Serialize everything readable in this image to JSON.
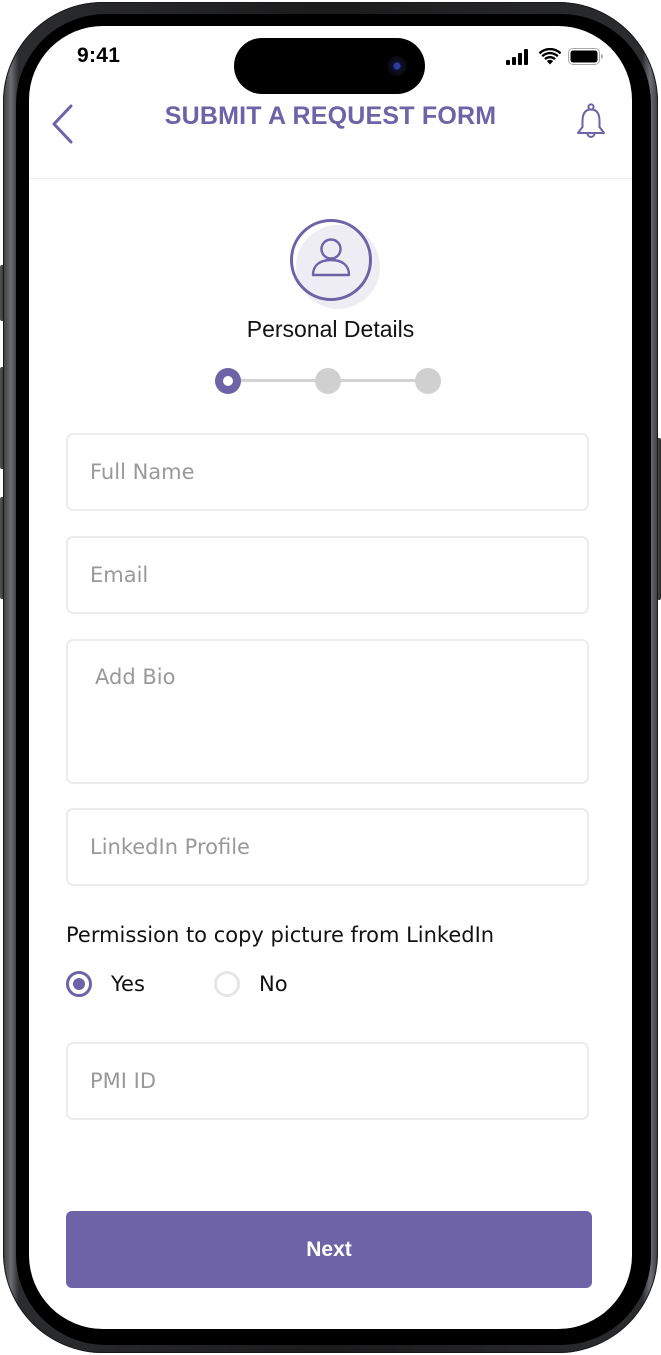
{
  "status_bar": {
    "time": "9:41",
    "icons": [
      "cellular-signal-icon",
      "wifi-icon",
      "battery-icon"
    ]
  },
  "header": {
    "title": "SUBMIT A REQUEST FORM",
    "back_icon": "chevron-left-icon",
    "notification_icon": "bell-icon"
  },
  "step": {
    "icon": "user-icon",
    "title": "Personal Details",
    "total_steps": 3,
    "current_step": 1
  },
  "form": {
    "full_name": {
      "value": "",
      "placeholder": "Full Name"
    },
    "email": {
      "value": "",
      "placeholder": "Email"
    },
    "bio": {
      "value": "",
      "placeholder": "Add Bio"
    },
    "linkedin": {
      "value": "",
      "placeholder": "LinkedIn Profile"
    },
    "permission": {
      "label": "Permission to copy picture from LinkedIn",
      "options": [
        {
          "label": "Yes",
          "selected": true
        },
        {
          "label": "No",
          "selected": false
        }
      ]
    },
    "pmi_id": {
      "value": "",
      "placeholder": "PMI ID"
    }
  },
  "actions": {
    "next_label": "Next"
  },
  "colors": {
    "accent": "#6e63a6",
    "inactive_step": "#d0d0d0",
    "field_border": "#ececec",
    "placeholder": "#999999"
  }
}
